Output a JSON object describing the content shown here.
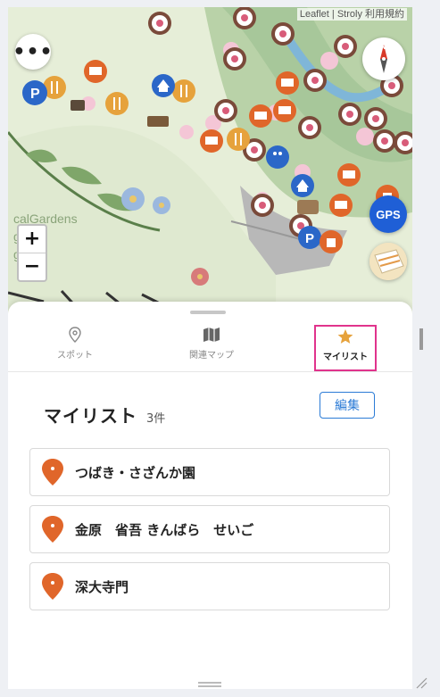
{
  "map": {
    "attribution": "Leaflet | Stroly 利用規約",
    "zoom_in": "+",
    "zoom_out": "−",
    "gps_label": "GPS",
    "more_label": "•••",
    "compass_label": "N"
  },
  "tabs": [
    {
      "label": "スポット",
      "icon": "location-pin-icon"
    },
    {
      "label": "関連マップ",
      "icon": "map-icon"
    },
    {
      "label": "マイリスト",
      "icon": "star-icon",
      "active": true
    }
  ],
  "mylist": {
    "title": "マイリスト",
    "count": "3件",
    "edit_label": "編集",
    "items": [
      {
        "label": "つばき・さざんか園"
      },
      {
        "label": "金原　省吾 きんばら　せいご"
      },
      {
        "label": "深大寺門"
      }
    ]
  },
  "colors": {
    "accent_pink": "#e0338c",
    "link_blue": "#2b7bd6",
    "pin_orange": "#e0662a",
    "gps_blue": "#1f5fd6",
    "star_gold": "#e6a23c"
  }
}
